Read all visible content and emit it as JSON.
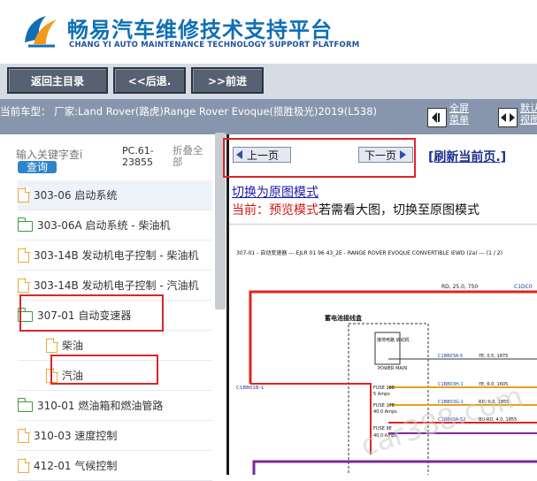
{
  "header": {
    "brand_cn": "畅易汽车维修技术支持平台",
    "brand_en": "CHANG YI AUTO MAINTENANCE TECHNOLOGY SUPPORT PLATFORM",
    "accent": "#0f6fb5"
  },
  "nav": {
    "home": "返回主目录",
    "back": "<<后退.",
    "forward": ">>前进"
  },
  "vehicle": {
    "text": "当前车型： 厂家:Land Rover(路虎)Range Rover Evoque(揽胜极光)2019(L538)",
    "fullscreen_line1": "全屏",
    "fullscreen_line2": "菜单",
    "default_line1": "默认",
    "default_line2": "视图"
  },
  "left": {
    "search_placeholder": "输入关键字查i",
    "search_button": "查询",
    "pc_line1": "PC.61-",
    "pc_line2": "23855",
    "collapse_line1": "折叠全",
    "collapse_line2": "部",
    "tree": [
      {
        "label": "303-06 启动系统",
        "icon": "document-icon"
      },
      {
        "label": "303-06A 启动系统 - 柴油机",
        "icon": "folder-icon"
      },
      {
        "label": "303-14B 发动机电子控制 - 柴油机",
        "icon": "document-icon"
      },
      {
        "label": "303-14B 发动机电子控制 - 汽油机",
        "icon": "document-icon"
      },
      {
        "label": "307-01 自动变速器",
        "icon": "folder-icon"
      },
      {
        "label": "柴油",
        "icon": "document-icon"
      },
      {
        "label": "汽油",
        "icon": "document-icon"
      },
      {
        "label": "310-01 燃油箱和燃油管路",
        "icon": "folder-icon"
      },
      {
        "label": "310-03 速度控制",
        "icon": "document-icon"
      },
      {
        "label": "412-01 气候控制",
        "icon": "document-icon"
      }
    ]
  },
  "right": {
    "prev_page": "上一页",
    "next_page": "下一页",
    "refresh": "[刷新当前页.]",
    "switch_mode": "切换为原图模式",
    "mode_prefix": "当前：",
    "mode_name": "预览模式",
    "mode_suffix": "若需看大图，切换至原图模式"
  },
  "diagram": {
    "title": "307-01 - 自动变速器 --- EJLR 01 96 43_2E - RANGE ROVER EVOQUE CONVERTIBLE iEWD (2a) --- (1 / 2)",
    "wire_top": "RD, 25.0, 750",
    "connector_top_right": "C1DC0",
    "box_title": "蓄电池接线盒",
    "component": "接地电路 启动机",
    "power_main": "POWER MAIN",
    "connector_left": "C1BB01B-1",
    "fuse_1": "FUSE 18E",
    "fuse_1_amp": "5 Amps",
    "fuse_2": "FUSE 17E",
    "fuse_2_amp": "40.0 Amps",
    "fuse_3": "FUSE 9E",
    "fuse_3_amp": "40.0 Amps",
    "rows": [
      {
        "connector": "C1BB03A-5",
        "wire": "YE, 0.5, 1875"
      },
      {
        "connector": "C1BB03H-1",
        "wire": "YE, 6.0, 1605"
      },
      {
        "connector": "C1BB03G-1",
        "wire": "RD, 6.0, 1855"
      },
      {
        "connector": "C1BB03A-52",
        "wire": "BU-RD, 4.0, 1855"
      }
    ],
    "watermark": "car388.com"
  }
}
